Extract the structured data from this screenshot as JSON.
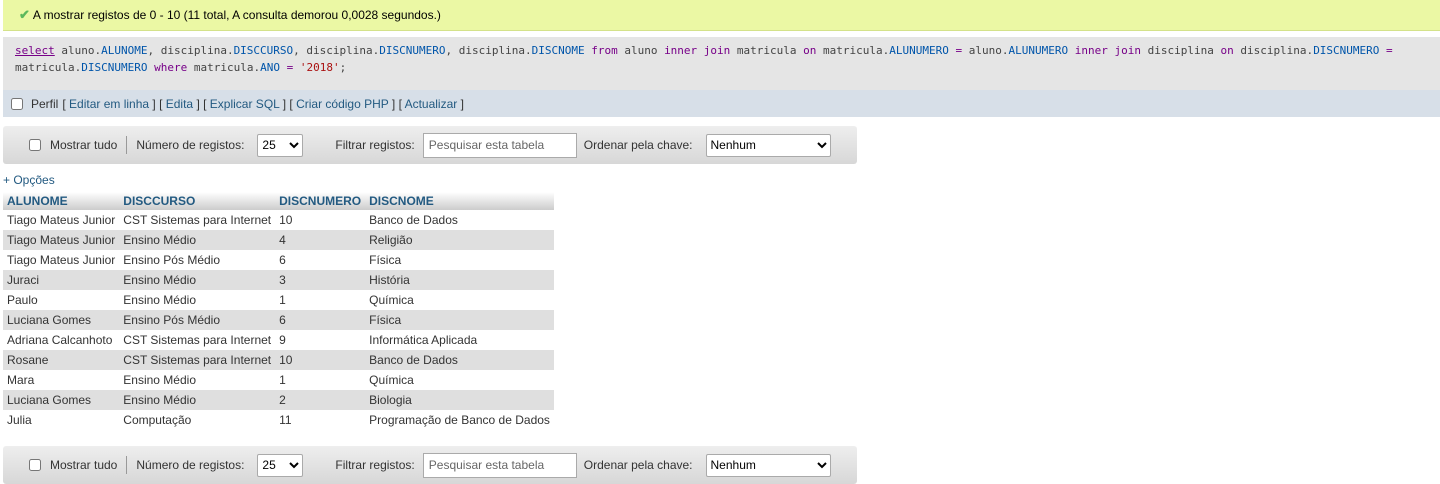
{
  "message": {
    "text": "A mostrar registos de 0 - 10 (11 total, A consulta demorou 0,0028 segundos.)",
    "icon": "check-icon"
  },
  "sql": {
    "tokens": [
      {
        "t": "select",
        "c": "kw-u"
      },
      {
        "t": " aluno.",
        "c": "plain"
      },
      {
        "t": "ALUNOME",
        "c": "col"
      },
      {
        "t": ", disciplina.",
        "c": "plain"
      },
      {
        "t": "DISCCURSO",
        "c": "col"
      },
      {
        "t": ", disciplina.",
        "c": "plain"
      },
      {
        "t": "DISCNUMERO",
        "c": "col"
      },
      {
        "t": ", disciplina.",
        "c": "plain"
      },
      {
        "t": "DISCNOME",
        "c": "col"
      },
      {
        "t": " ",
        "c": "plain"
      },
      {
        "t": "from",
        "c": "kw"
      },
      {
        "t": " aluno ",
        "c": "plain"
      },
      {
        "t": "inner join",
        "c": "kw"
      },
      {
        "t": " matricula ",
        "c": "plain"
      },
      {
        "t": "on",
        "c": "kw"
      },
      {
        "t": " matricula.",
        "c": "plain"
      },
      {
        "t": "ALUNUMERO",
        "c": "col"
      },
      {
        "t": " = ",
        "c": "kw"
      },
      {
        "t": "aluno.",
        "c": "plain"
      },
      {
        "t": "ALUNUMERO",
        "c": "col"
      },
      {
        "t": " ",
        "c": "plain"
      },
      {
        "t": "inner join",
        "c": "kw"
      },
      {
        "t": " disciplina ",
        "c": "plain"
      },
      {
        "t": "on",
        "c": "kw"
      },
      {
        "t": " disciplina.",
        "c": "plain"
      },
      {
        "t": "DISCNUMERO",
        "c": "col"
      },
      {
        "t": " =",
        "c": "kw"
      },
      {
        "t": "\n",
        "c": "plain"
      },
      {
        "t": "matricula.",
        "c": "plain"
      },
      {
        "t": "DISCNUMERO",
        "c": "col"
      },
      {
        "t": " ",
        "c": "plain"
      },
      {
        "t": "where",
        "c": "kw"
      },
      {
        "t": " matricula.",
        "c": "plain"
      },
      {
        "t": "ANO",
        "c": "col"
      },
      {
        "t": " = ",
        "c": "kw"
      },
      {
        "t": "'2018'",
        "c": "str"
      },
      {
        "t": ";",
        "c": "plain"
      }
    ]
  },
  "sql_links": {
    "profile_label": "Perfil",
    "links": [
      "Editar em linha",
      "Edita",
      "Explicar SQL",
      "Criar código PHP",
      "Actualizar"
    ]
  },
  "navbar": {
    "show_all_label": "Mostrar tudo",
    "num_records_label": "Número de registos:",
    "num_records_value": "25",
    "filter_label": "Filtrar registos:",
    "filter_placeholder": "Pesquisar esta tabela",
    "order_label": "Ordenar pela chave:",
    "order_value": "Nenhum"
  },
  "options_label": "+ Opções",
  "table": {
    "columns": [
      "ALUNOME",
      "DISCCURSO",
      "DISCNUMERO",
      "DISCNOME"
    ],
    "rows": [
      [
        "Tiago Mateus Junior",
        "CST Sistemas para Internet",
        "10",
        "Banco de Dados"
      ],
      [
        "Tiago Mateus Junior",
        "Ensino Médio",
        "4",
        "Religião"
      ],
      [
        "Tiago Mateus Junior",
        "Ensino Pós Médio",
        "6",
        "Física"
      ],
      [
        "Juraci",
        "Ensino Médio",
        "3",
        "História"
      ],
      [
        "Paulo",
        "Ensino Médio",
        "1",
        "Química"
      ],
      [
        "Luciana Gomes",
        "Ensino Pós Médio",
        "6",
        "Física"
      ],
      [
        "Adriana Calcanhoto",
        "CST Sistemas para Internet",
        "9",
        "Informática Aplicada"
      ],
      [
        "Rosane",
        "CST Sistemas para Internet",
        "10",
        "Banco de Dados"
      ],
      [
        "Mara",
        "Ensino Médio",
        "1",
        "Química"
      ],
      [
        "Luciana Gomes",
        "Ensino Médio",
        "2",
        "Biologia"
      ],
      [
        "Julia",
        "Computação",
        "11",
        "Programação de Banco de Dados"
      ]
    ]
  }
}
